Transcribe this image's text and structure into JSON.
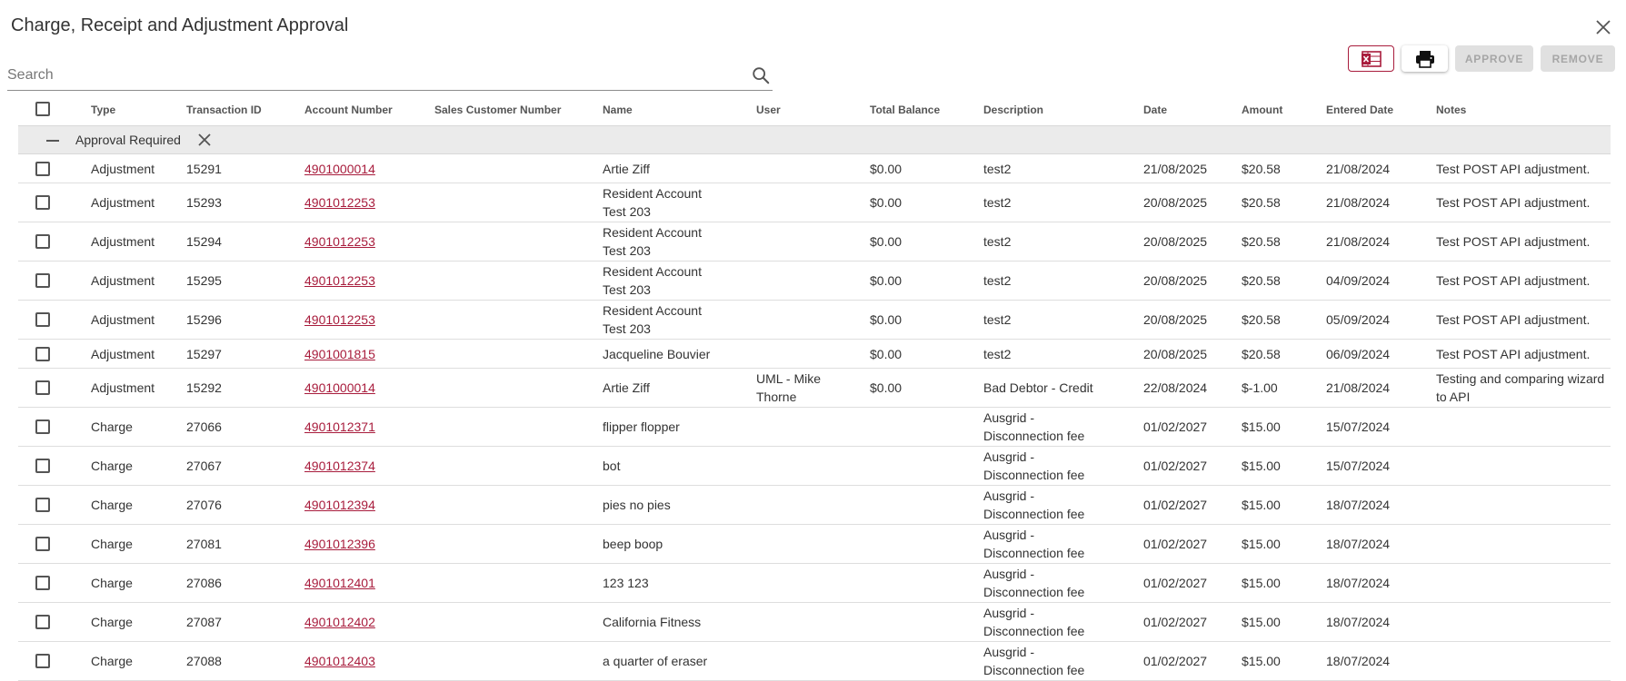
{
  "dialog": {
    "title": "Charge, Receipt and Adjustment Approval"
  },
  "search": {
    "placeholder": "Search",
    "value": ""
  },
  "toolbar": {
    "approve_label": "APPROVE",
    "remove_label": "REMOVE",
    "excel_icon": "excel-export-icon",
    "print_icon": "print-icon",
    "accent_color": "#a81c3c"
  },
  "table": {
    "columns": {
      "type": "Type",
      "transaction_id": "Transaction ID",
      "account_number": "Account Number",
      "sales_customer_number": "Sales Customer Number",
      "name": "Name",
      "user": "User",
      "total_balance": "Total Balance",
      "description": "Description",
      "date": "Date",
      "amount": "Amount",
      "entered_date": "Entered Date",
      "notes": "Notes"
    },
    "group": {
      "label": "Approval Required"
    },
    "rows": [
      {
        "type": "Adjustment",
        "transaction_id": "15291",
        "account_number": "4901000014",
        "sales_customer_number": "",
        "name": "Artie Ziff",
        "user": "",
        "total_balance": "$0.00",
        "description": "test2",
        "date": "21/08/2025",
        "amount": "$20.58",
        "entered_date": "21/08/2024",
        "notes": "Test POST API adjustment."
      },
      {
        "type": "Adjustment",
        "transaction_id": "15293",
        "account_number": "4901012253",
        "sales_customer_number": "",
        "name": "Resident Account Test 203",
        "user": "",
        "total_balance": "$0.00",
        "description": "test2",
        "date": "20/08/2025",
        "amount": "$20.58",
        "entered_date": "21/08/2024",
        "notes": "Test POST API adjustment."
      },
      {
        "type": "Adjustment",
        "transaction_id": "15294",
        "account_number": "4901012253",
        "sales_customer_number": "",
        "name": "Resident Account Test 203",
        "user": "",
        "total_balance": "$0.00",
        "description": "test2",
        "date": "20/08/2025",
        "amount": "$20.58",
        "entered_date": "21/08/2024",
        "notes": "Test POST API adjustment."
      },
      {
        "type": "Adjustment",
        "transaction_id": "15295",
        "account_number": "4901012253",
        "sales_customer_number": "",
        "name": "Resident Account Test 203",
        "user": "",
        "total_balance": "$0.00",
        "description": "test2",
        "date": "20/08/2025",
        "amount": "$20.58",
        "entered_date": "04/09/2024",
        "notes": "Test POST API adjustment."
      },
      {
        "type": "Adjustment",
        "transaction_id": "15296",
        "account_number": "4901012253",
        "sales_customer_number": "",
        "name": "Resident Account Test 203",
        "user": "",
        "total_balance": "$0.00",
        "description": "test2",
        "date": "20/08/2025",
        "amount": "$20.58",
        "entered_date": "05/09/2024",
        "notes": "Test POST API adjustment."
      },
      {
        "type": "Adjustment",
        "transaction_id": "15297",
        "account_number": "4901001815",
        "sales_customer_number": "",
        "name": "Jacqueline Bouvier",
        "user": "",
        "total_balance": "$0.00",
        "description": "test2",
        "date": "20/08/2025",
        "amount": "$20.58",
        "entered_date": "06/09/2024",
        "notes": "Test POST API adjustment."
      },
      {
        "type": "Adjustment",
        "transaction_id": "15292",
        "account_number": "4901000014",
        "sales_customer_number": "",
        "name": "Artie Ziff",
        "user": "UML - Mike Thorne",
        "total_balance": "$0.00",
        "description": "Bad Debtor - Credit",
        "date": "22/08/2024",
        "amount": "$-1.00",
        "entered_date": "21/08/2024",
        "notes": "Testing and comparing wizard to API"
      },
      {
        "type": "Charge",
        "transaction_id": "27066",
        "account_number": "4901012371",
        "sales_customer_number": "",
        "name": "flipper flopper",
        "user": "",
        "total_balance": "",
        "description": "Ausgrid - Disconnection fee",
        "date": "01/02/2027",
        "amount": "$15.00",
        "entered_date": "15/07/2024",
        "notes": ""
      },
      {
        "type": "Charge",
        "transaction_id": "27067",
        "account_number": "4901012374",
        "sales_customer_number": "",
        "name": "bot",
        "user": "",
        "total_balance": "",
        "description": "Ausgrid - Disconnection fee",
        "date": "01/02/2027",
        "amount": "$15.00",
        "entered_date": "15/07/2024",
        "notes": ""
      },
      {
        "type": "Charge",
        "transaction_id": "27076",
        "account_number": "4901012394",
        "sales_customer_number": "",
        "name": "pies no pies",
        "user": "",
        "total_balance": "",
        "description": "Ausgrid - Disconnection fee",
        "date": "01/02/2027",
        "amount": "$15.00",
        "entered_date": "18/07/2024",
        "notes": ""
      },
      {
        "type": "Charge",
        "transaction_id": "27081",
        "account_number": "4901012396",
        "sales_customer_number": "",
        "name": "beep boop",
        "user": "",
        "total_balance": "",
        "description": "Ausgrid - Disconnection fee",
        "date": "01/02/2027",
        "amount": "$15.00",
        "entered_date": "18/07/2024",
        "notes": ""
      },
      {
        "type": "Charge",
        "transaction_id": "27086",
        "account_number": "4901012401",
        "sales_customer_number": "",
        "name": "123 123",
        "user": "",
        "total_balance": "",
        "description": "Ausgrid - Disconnection fee",
        "date": "01/02/2027",
        "amount": "$15.00",
        "entered_date": "18/07/2024",
        "notes": ""
      },
      {
        "type": "Charge",
        "transaction_id": "27087",
        "account_number": "4901012402",
        "sales_customer_number": "",
        "name": "California Fitness",
        "user": "",
        "total_balance": "",
        "description": "Ausgrid - Disconnection fee",
        "date": "01/02/2027",
        "amount": "$15.00",
        "entered_date": "18/07/2024",
        "notes": ""
      },
      {
        "type": "Charge",
        "transaction_id": "27088",
        "account_number": "4901012403",
        "sales_customer_number": "",
        "name": "a quarter of eraser",
        "user": "",
        "total_balance": "",
        "description": "Ausgrid - Disconnection fee",
        "date": "01/02/2027",
        "amount": "$15.00",
        "entered_date": "18/07/2024",
        "notes": ""
      }
    ]
  }
}
